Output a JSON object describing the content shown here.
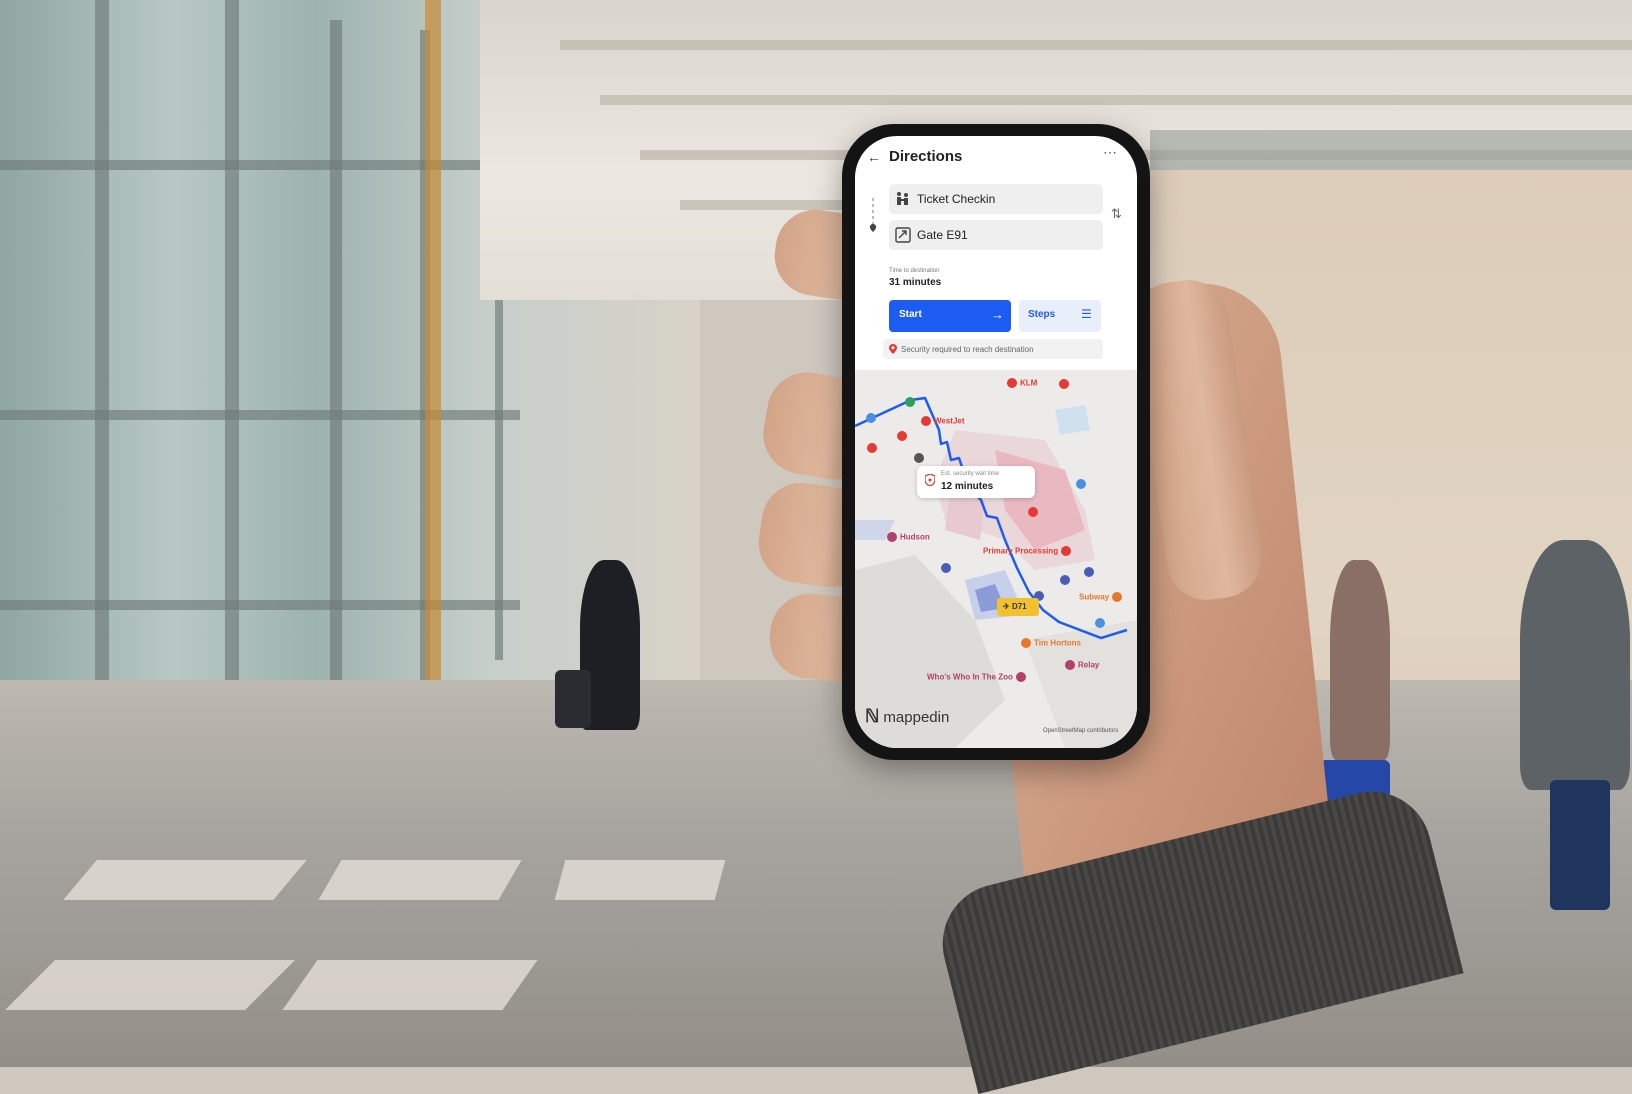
{
  "app": {
    "title": "Directions"
  },
  "route": {
    "origin": "Ticket Checkin",
    "destination": "Gate E91",
    "time_label": "Time to destination",
    "time_value": "31 minutes"
  },
  "actions": {
    "start_label": "Start",
    "steps_label": "Steps"
  },
  "notice": "Security required to reach destination",
  "map": {
    "wait_label": "Est. security wait time",
    "wait_value": "12 minutes",
    "gate_label": "D71",
    "brand": "mappedin",
    "attribution": "OpenStreetMap contributors",
    "pois": [
      {
        "label": "KLM",
        "color": "#e53935"
      },
      {
        "label": "WestJet",
        "color": "#e53935"
      },
      {
        "label": "Hudson",
        "color": "#b0416a"
      },
      {
        "label": "Primary Processing",
        "color": "#e53935"
      },
      {
        "label": "Subway",
        "color": "#e8772e"
      },
      {
        "label": "Tim Hortons",
        "color": "#e8772e"
      },
      {
        "label": "Relay",
        "color": "#b0416a"
      },
      {
        "label": "Who's Who In The Zoo",
        "color": "#b0416a"
      }
    ]
  },
  "colors": {
    "accent": "#1d5cf2",
    "route": "#1d5cf2",
    "poi_red": "#e53935",
    "poi_orange": "#e8772e",
    "gate_yellow": "#f2c12e"
  },
  "icons": [
    "back-arrow-icon",
    "more-icon",
    "ticket-checkin-icon",
    "gate-icon",
    "location-pin-icon",
    "swap-icon",
    "arrow-right-icon",
    "list-icon",
    "shield-icon",
    "plane-icon"
  ]
}
